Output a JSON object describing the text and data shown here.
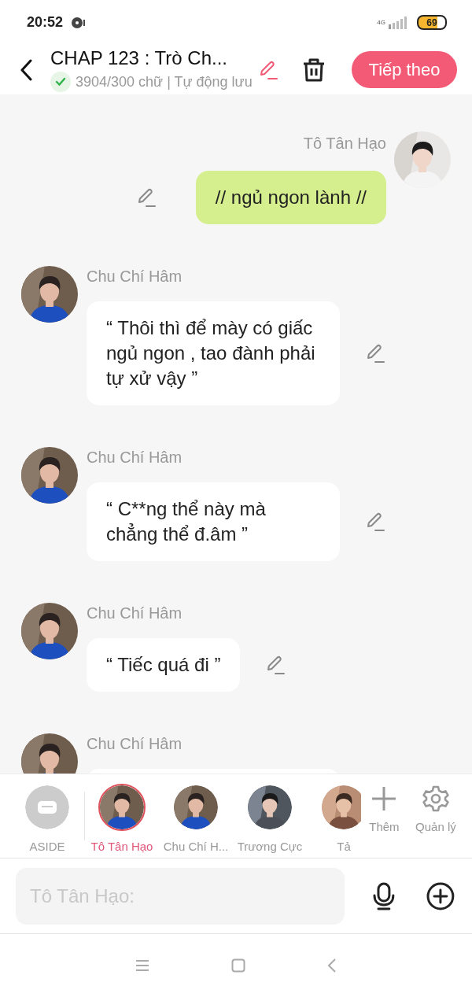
{
  "status_bar": {
    "time": "20:52",
    "network": "4G",
    "battery": "69"
  },
  "header": {
    "title": "CHAP 123 : Trò Ch...",
    "saved": true,
    "subtitle": "3904/300 chữ | Tự động lưu",
    "next_button": "Tiếp theo"
  },
  "messages": [
    {
      "kind": "self",
      "sender": "Tô Tân Hạo",
      "text": "// ngủ ngon lành //"
    },
    {
      "kind": "other",
      "sender": "Chu Chí Hâm",
      "text": "“ Thôi thì để mày có giấc ngủ ngon , tao đành phải tự xử vậy ”"
    },
    {
      "kind": "other",
      "sender": "Chu Chí Hâm",
      "text": "“ C**ng thể này mà chẳng thể đ.âm ”"
    },
    {
      "kind": "other",
      "sender": "Chu Chí Hâm",
      "text": "“ Tiếc quá đi ”"
    },
    {
      "kind": "other",
      "sender": "Chu Chí Hâm"
    }
  ],
  "characters": [
    {
      "kind": "aside",
      "label": "ASIDE",
      "selected": false
    },
    {
      "kind": "person",
      "label": "Tô Tân Hạo",
      "selected": true
    },
    {
      "kind": "person",
      "label": "Chu Chí H...",
      "selected": false
    },
    {
      "kind": "person",
      "label": "Trương Cực",
      "selected": false
    },
    {
      "kind": "person",
      "label": "Tả",
      "selected": false
    }
  ],
  "actions": [
    {
      "kind": "add",
      "label": "Thêm"
    },
    {
      "kind": "settings",
      "label": "Quản lý"
    }
  ],
  "composer": {
    "placeholder": "Tô Tân Hạo:"
  }
}
